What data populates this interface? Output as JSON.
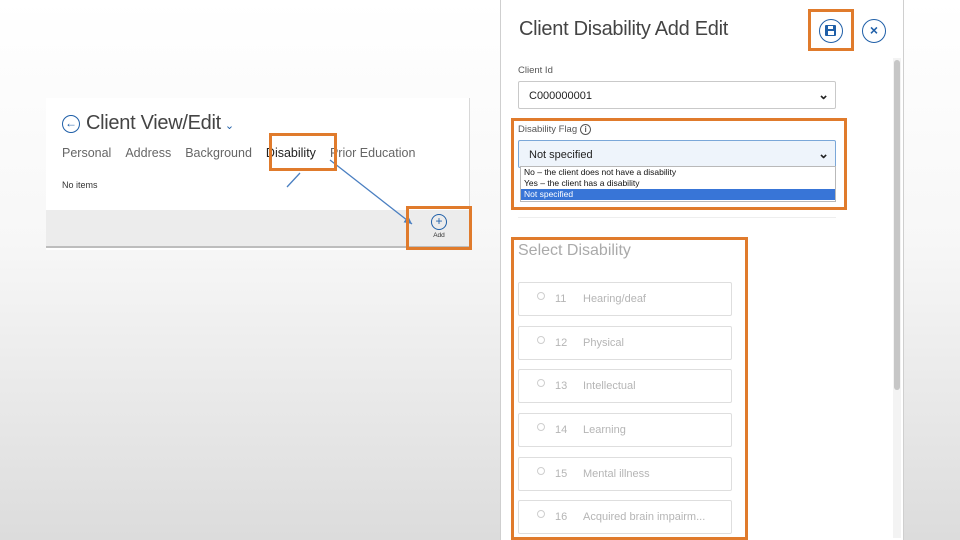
{
  "client_view": {
    "title": "Client View/Edit",
    "tabs": [
      "Personal",
      "Address",
      "Background",
      "Disability",
      "Prior Education"
    ],
    "empty_text": "No items",
    "add_label": "Add"
  },
  "dialog": {
    "title": "Client Disability Add Edit",
    "client_id": {
      "label": "Client Id",
      "value": "C000000001"
    },
    "disability_flag": {
      "label": "Disability Flag",
      "value": "Not specified",
      "options": [
        "No – the client does not have a disability",
        "Yes – the client has a disability",
        "Not specified"
      ],
      "selected_index": 2
    },
    "select_disability": {
      "title": "Select Disability",
      "items": [
        {
          "code": "11",
          "name": "Hearing/deaf"
        },
        {
          "code": "12",
          "name": "Physical"
        },
        {
          "code": "13",
          "name": "Intellectual"
        },
        {
          "code": "14",
          "name": "Learning"
        },
        {
          "code": "15",
          "name": "Mental illness"
        },
        {
          "code": "16",
          "name": "Acquired brain impairm..."
        }
      ]
    }
  },
  "colors": {
    "highlight": "#e07b2c",
    "accent": "#1f5fa8",
    "selected_option": "#3875d7"
  },
  "icons": [
    "back-arrow-icon",
    "chevron-down-icon",
    "plus-circle-icon",
    "save-icon",
    "close-icon",
    "info-icon",
    "caret-down-icon"
  ]
}
